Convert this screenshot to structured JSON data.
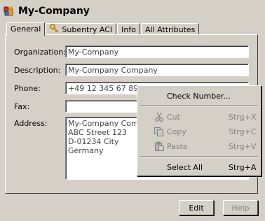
{
  "window": {
    "title": "My-Company"
  },
  "tabs": [
    {
      "label": "General",
      "active": true
    },
    {
      "label": "Subentry ACI",
      "icon": "key-icon"
    },
    {
      "label": "Info"
    },
    {
      "label": "All Attributes"
    }
  ],
  "form": {
    "organization": {
      "label": "Organization:",
      "value": "My-Company"
    },
    "description": {
      "label": "Description:",
      "value": "My-Company Company"
    },
    "phone": {
      "label": "Phone:",
      "value": "+49 12 345 67 890"
    },
    "fax": {
      "label": "Fax:",
      "value": ""
    },
    "address": {
      "label": "Address:",
      "value": "My-Company Compan\nABC Street 123\nD-01234 City\nGermany"
    }
  },
  "buttons": {
    "edit": "Edit",
    "help": "Help"
  },
  "context_menu": {
    "check_number": "Check Number...",
    "cut": {
      "label": "Cut",
      "shortcut": "Strg+X"
    },
    "copy": {
      "label": "Copy",
      "shortcut": "Strg+C"
    },
    "paste": {
      "label": "Paste",
      "shortcut": "Strg+V"
    },
    "select_all": {
      "label": "Select All",
      "shortcut": "Strg+A"
    }
  }
}
